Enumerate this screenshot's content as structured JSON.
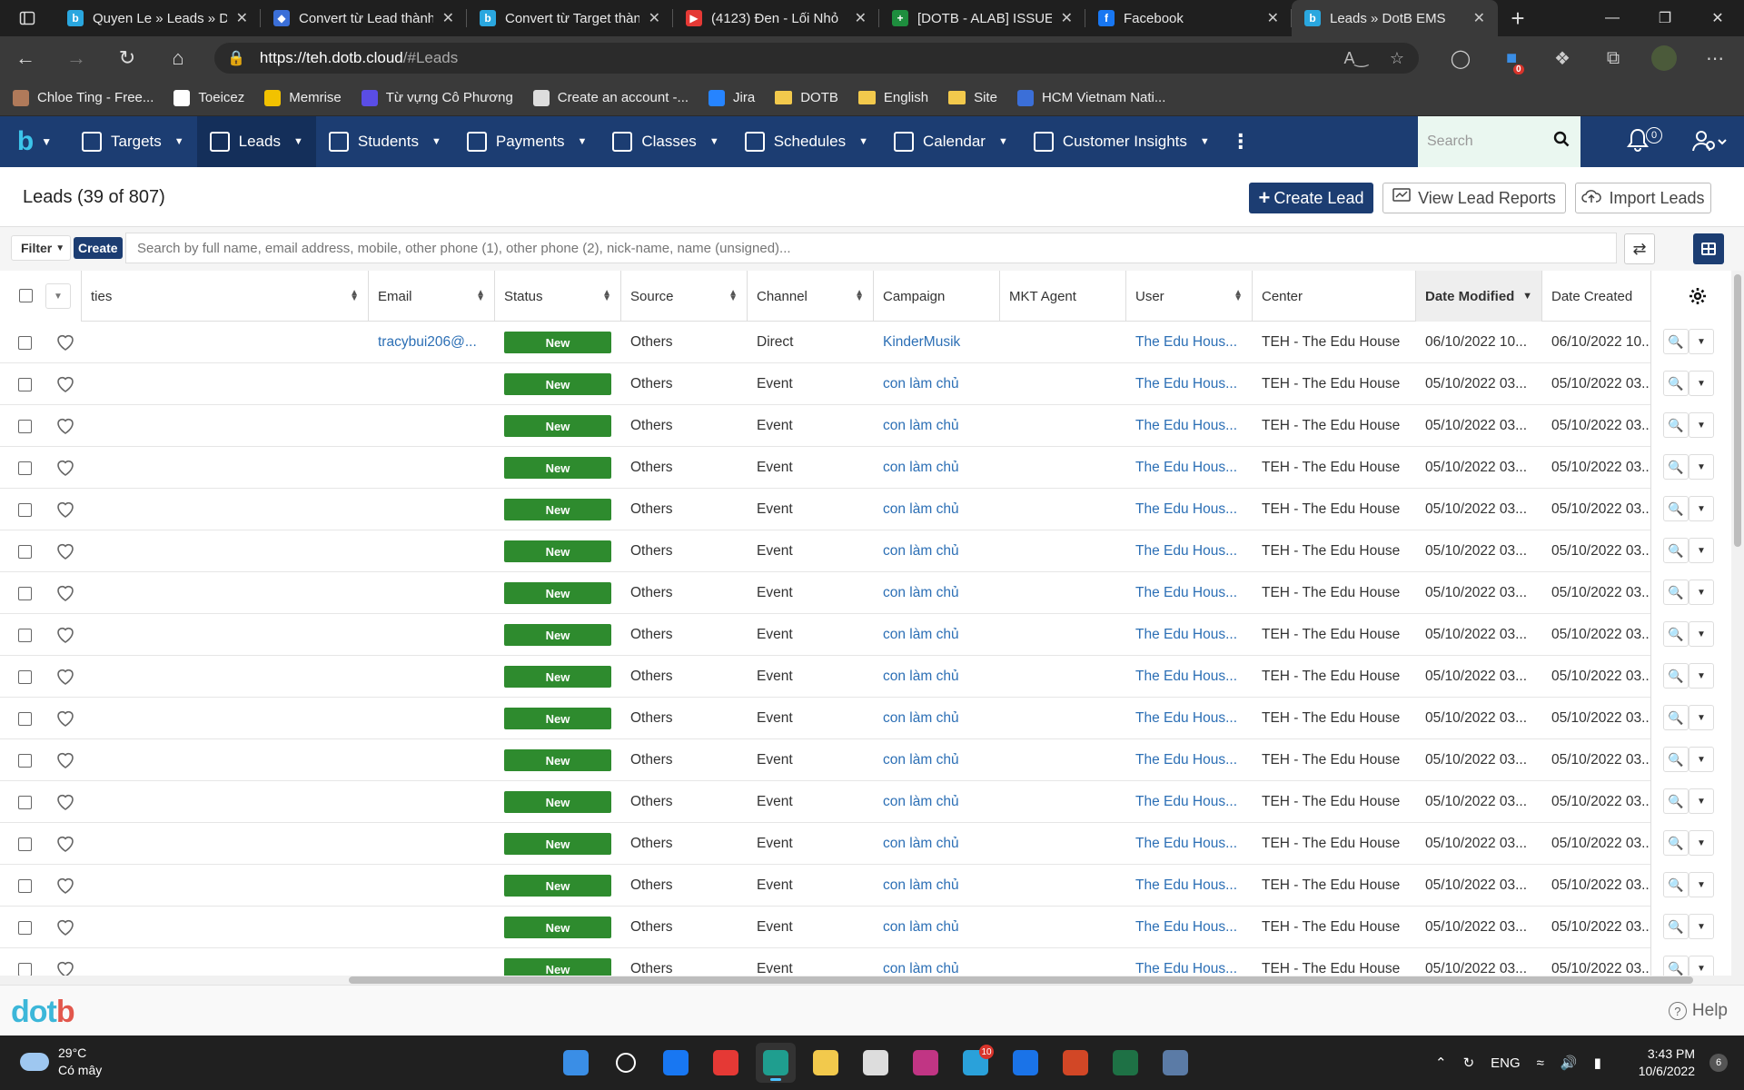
{
  "browser": {
    "tabs": [
      {
        "title": "Quyen Le » Leads » DotB EMS",
        "favicon_color": "#2aa7df",
        "favicon_glyph": "b"
      },
      {
        "title": "Convert từ Lead thành Student",
        "favicon_color": "#3b6fd8",
        "favicon_glyph": "◆"
      },
      {
        "title": "Convert từ Target thành Lead",
        "favicon_color": "#2aa7df",
        "favicon_glyph": "b"
      },
      {
        "title": "(4123) Đen - Lối Nhỏ",
        "favicon_color": "#e53935",
        "favicon_glyph": "▶"
      },
      {
        "title": "[DOTB - ALAB] ISSUE LIST",
        "favicon_color": "#1e8e3e",
        "favicon_glyph": "+"
      },
      {
        "title": "Facebook",
        "favicon_color": "#1877f2",
        "favicon_glyph": "f"
      },
      {
        "title": "Leads » DotB EMS",
        "favicon_color": "#2aa7df",
        "favicon_glyph": "b",
        "active": true
      }
    ],
    "url_host": "https://teh.dotb.cloud",
    "url_path": "/#Leads",
    "extension_badge": "0"
  },
  "bookmarks": [
    {
      "label": "Chloe Ting - Free...",
      "icon_color": "#b07a5a"
    },
    {
      "label": "Toeicez",
      "icon_color": "#ffffff"
    },
    {
      "label": "Memrise",
      "icon_color": "#f2c200"
    },
    {
      "label": "Từ vựng Cô Phương",
      "icon_color": "#5a4de6"
    },
    {
      "label": "Create an account -...",
      "icon_color": "#dddddd"
    },
    {
      "label": "Jira",
      "icon_color": "#2684ff"
    },
    {
      "label": "DOTB",
      "folder": true
    },
    {
      "label": "English",
      "folder": true
    },
    {
      "label": "Site",
      "folder": true
    },
    {
      "label": "HCM Vietnam Nati...",
      "icon_color": "#3b6fd8"
    }
  ],
  "appnav": {
    "items": [
      {
        "label": "Targets"
      },
      {
        "label": "Leads",
        "active": true
      },
      {
        "label": "Students"
      },
      {
        "label": "Payments"
      },
      {
        "label": "Classes"
      },
      {
        "label": "Schedules"
      },
      {
        "label": "Calendar"
      },
      {
        "label": "Customer Insights"
      }
    ],
    "search_placeholder": "Search",
    "notification_count": "0"
  },
  "page": {
    "title": "Leads (39 of 807)",
    "create_lead": "Create Lead",
    "view_reports": "View Lead Reports",
    "import_leads": "Import Leads"
  },
  "filterbar": {
    "filter_label": "Filter",
    "create_label": "Create",
    "search_placeholder": "Search by full name, email address, mobile, other phone (1), other phone (2), nick-name, name (unsigned)..."
  },
  "table": {
    "columns": {
      "activities": "ties",
      "email": "Email",
      "status": "Status",
      "source": "Source",
      "channel": "Channel",
      "campaign": "Campaign",
      "mkt_agent": "MKT Agent",
      "user": "User",
      "center": "Center",
      "date_modified": "Date Modified",
      "date_created": "Date Created"
    },
    "sorted_column": "Date Modified",
    "rows": [
      {
        "email": "tracybui206@...",
        "status": "New",
        "source": "Others",
        "channel": "Direct",
        "campaign": "KinderMusik",
        "mkt_agent": "",
        "user": "The Edu Hous...",
        "center": "TEH - The Edu House",
        "date_modified": "06/10/2022 10...",
        "date_created": "06/10/2022 10..."
      },
      {
        "email": "",
        "status": "New",
        "source": "Others",
        "channel": "Event",
        "campaign": "con làm chủ",
        "mkt_agent": "",
        "user": "The Edu Hous...",
        "center": "TEH - The Edu House",
        "date_modified": "05/10/2022 03...",
        "date_created": "05/10/2022 03..."
      },
      {
        "email": "",
        "status": "New",
        "source": "Others",
        "channel": "Event",
        "campaign": "con làm chủ",
        "mkt_agent": "",
        "user": "The Edu Hous...",
        "center": "TEH - The Edu House",
        "date_modified": "05/10/2022 03...",
        "date_created": "05/10/2022 03..."
      },
      {
        "email": "",
        "status": "New",
        "source": "Others",
        "channel": "Event",
        "campaign": "con làm chủ",
        "mkt_agent": "",
        "user": "The Edu Hous...",
        "center": "TEH - The Edu House",
        "date_modified": "05/10/2022 03...",
        "date_created": "05/10/2022 03..."
      },
      {
        "email": "",
        "status": "New",
        "source": "Others",
        "channel": "Event",
        "campaign": "con làm chủ",
        "mkt_agent": "",
        "user": "The Edu Hous...",
        "center": "TEH - The Edu House",
        "date_modified": "05/10/2022 03...",
        "date_created": "05/10/2022 03..."
      },
      {
        "email": "",
        "status": "New",
        "source": "Others",
        "channel": "Event",
        "campaign": "con làm chủ",
        "mkt_agent": "",
        "user": "The Edu Hous...",
        "center": "TEH - The Edu House",
        "date_modified": "05/10/2022 03...",
        "date_created": "05/10/2022 03..."
      },
      {
        "email": "",
        "status": "New",
        "source": "Others",
        "channel": "Event",
        "campaign": "con làm chủ",
        "mkt_agent": "",
        "user": "The Edu Hous...",
        "center": "TEH - The Edu House",
        "date_modified": "05/10/2022 03...",
        "date_created": "05/10/2022 03..."
      },
      {
        "email": "",
        "status": "New",
        "source": "Others",
        "channel": "Event",
        "campaign": "con làm chủ",
        "mkt_agent": "",
        "user": "The Edu Hous...",
        "center": "TEH - The Edu House",
        "date_modified": "05/10/2022 03...",
        "date_created": "05/10/2022 03..."
      },
      {
        "email": "",
        "status": "New",
        "source": "Others",
        "channel": "Event",
        "campaign": "con làm chủ",
        "mkt_agent": "",
        "user": "The Edu Hous...",
        "center": "TEH - The Edu House",
        "date_modified": "05/10/2022 03...",
        "date_created": "05/10/2022 03..."
      },
      {
        "email": "",
        "status": "New",
        "source": "Others",
        "channel": "Event",
        "campaign": "con làm chủ",
        "mkt_agent": "",
        "user": "The Edu Hous...",
        "center": "TEH - The Edu House",
        "date_modified": "05/10/2022 03...",
        "date_created": "05/10/2022 03..."
      },
      {
        "email": "",
        "status": "New",
        "source": "Others",
        "channel": "Event",
        "campaign": "con làm chủ",
        "mkt_agent": "",
        "user": "The Edu Hous...",
        "center": "TEH - The Edu House",
        "date_modified": "05/10/2022 03...",
        "date_created": "05/10/2022 03..."
      },
      {
        "email": "",
        "status": "New",
        "source": "Others",
        "channel": "Event",
        "campaign": "con làm chủ",
        "mkt_agent": "",
        "user": "The Edu Hous...",
        "center": "TEH - The Edu House",
        "date_modified": "05/10/2022 03...",
        "date_created": "05/10/2022 03..."
      },
      {
        "email": "",
        "status": "New",
        "source": "Others",
        "channel": "Event",
        "campaign": "con làm chủ",
        "mkt_agent": "",
        "user": "The Edu Hous...",
        "center": "TEH - The Edu House",
        "date_modified": "05/10/2022 03...",
        "date_created": "05/10/2022 03..."
      },
      {
        "email": "",
        "status": "New",
        "source": "Others",
        "channel": "Event",
        "campaign": "con làm chủ",
        "mkt_agent": "",
        "user": "The Edu Hous...",
        "center": "TEH - The Edu House",
        "date_modified": "05/10/2022 03...",
        "date_created": "05/10/2022 03..."
      },
      {
        "email": "",
        "status": "New",
        "source": "Others",
        "channel": "Event",
        "campaign": "con làm chủ",
        "mkt_agent": "",
        "user": "The Edu Hous...",
        "center": "TEH - The Edu House",
        "date_modified": "05/10/2022 03...",
        "date_created": "05/10/2022 03..."
      },
      {
        "email": "",
        "status": "New",
        "source": "Others",
        "channel": "Event",
        "campaign": "con làm chủ",
        "mkt_agent": "",
        "user": "The Edu Hous...",
        "center": "TEH - The Edu House",
        "date_modified": "05/10/2022 03...",
        "date_created": "05/10/2022 03..."
      }
    ]
  },
  "footer": {
    "logo_text": "dotb",
    "help_label": "Help"
  },
  "taskbar": {
    "temperature": "29°C",
    "weather_desc": "Có mây",
    "apps": [
      {
        "name": "start",
        "color": "#3a8ee6"
      },
      {
        "name": "search",
        "color": "#202020"
      },
      {
        "name": "facebook",
        "color": "#1877f2"
      },
      {
        "name": "youtube",
        "color": "#e53935"
      },
      {
        "name": "edge",
        "color": "#1f9e8f",
        "active": true
      },
      {
        "name": "file-explorer",
        "color": "#f2c94c"
      },
      {
        "name": "wikipedia",
        "color": "#dddddd"
      },
      {
        "name": "instagram",
        "color": "#c13584"
      },
      {
        "name": "telegram",
        "color": "#2aa1da",
        "badge": "10"
      },
      {
        "name": "zalo",
        "color": "#1a73e8"
      },
      {
        "name": "powerpoint",
        "color": "#d24726"
      },
      {
        "name": "excel",
        "color": "#1e7145"
      },
      {
        "name": "settings",
        "color": "#5b7ba6"
      }
    ],
    "language": "ENG",
    "time": "3:43 PM",
    "date": "10/6/2022",
    "notification_count": "6"
  }
}
